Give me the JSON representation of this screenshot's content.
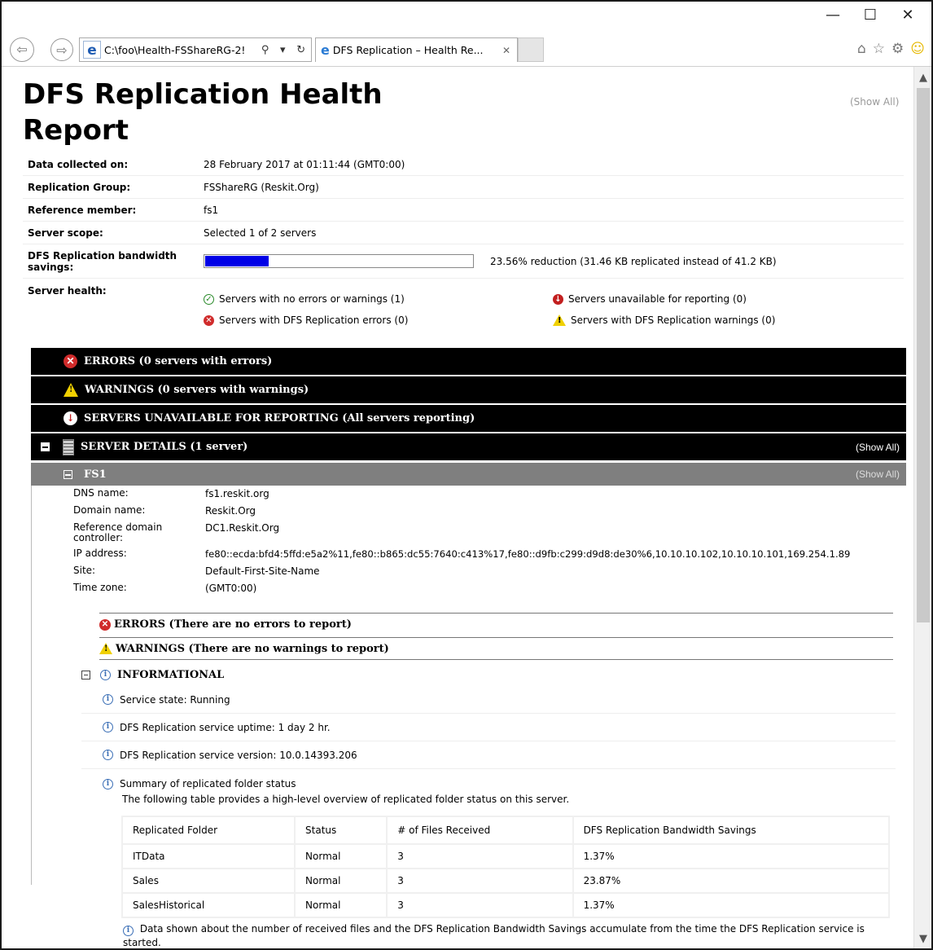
{
  "browser": {
    "address": "C:\\foo\\Health-FSShareRG-2!",
    "tab_title": "DFS Replication – Health Re...",
    "window_controls": [
      "—",
      "☐",
      "✕"
    ]
  },
  "report": {
    "title": "DFS Replication Health Report",
    "show_all": "(Show All)",
    "meta": [
      {
        "label": "Data collected on:",
        "value": "28 February 2017 at 01:11:44 (GMT0:00)"
      },
      {
        "label": "Replication Group:",
        "value": "FSShareRG (Reskit.Org)"
      },
      {
        "label": "Reference member:",
        "value": "fs1"
      },
      {
        "label": "Server scope:",
        "value": "Selected 1 of 2 servers"
      }
    ],
    "bandwidth": {
      "label": "DFS Replication bandwidth savings:",
      "percent": 23.56,
      "text": "23.56% reduction (31.46 KB replicated instead of 41.2 KB)"
    },
    "health": {
      "label": "Server health:",
      "ok": "Servers with no errors or warnings (1)",
      "errors": "Servers with DFS Replication errors (0)",
      "unavailable": "Servers unavailable for reporting (0)",
      "warnings": "Servers with DFS Replication warnings (0)"
    },
    "sections": {
      "errors": "ERRORS  (0 servers with errors)",
      "warnings": "WARNINGS  (0 servers with warnings)",
      "unavailable": "SERVERS UNAVAILABLE FOR REPORTING  (All servers reporting)",
      "details": "SERVER DETAILS  (1 server)",
      "details_show_all": "(Show All)"
    },
    "server": {
      "name": "FS1",
      "show_all": "(Show All)",
      "fields": [
        {
          "label": "DNS name:",
          "value": "fs1.reskit.org"
        },
        {
          "label": "Domain name:",
          "value": "Reskit.Org"
        },
        {
          "label": "Reference domain controller:",
          "value": "DC1.Reskit.Org"
        },
        {
          "label": "IP address:",
          "value": "fe80::ecda:bfd4:5ffd:e5a2%11,fe80::b865:dc55:7640:c413%17,fe80::d9fb:c299:d9d8:de30%6,10.10.10.102,10.10.10.101,169.254.1.89"
        },
        {
          "label": "Site:",
          "value": "Default-First-Site-Name"
        },
        {
          "label": "Time zone:",
          "value": "(GMT0:00)"
        }
      ],
      "errors": "ERRORS (There are no errors to report)",
      "warnings": "WARNINGS (There are no warnings to report)",
      "informational": "INFORMATIONAL",
      "info_items": [
        "Service state: Running",
        "DFS Replication service uptime: 1 day 2 hr.",
        "DFS Replication service version: 10.0.14393.206",
        "Summary of replicated folder status"
      ],
      "summary_desc": "The following table provides a high-level overview of replicated folder status on this server.",
      "table": {
        "headers": [
          "Replicated Folder",
          "Status",
          "# of Files Received",
          "DFS Replication Bandwidth Savings"
        ],
        "rows": [
          [
            "ITData",
            "Normal",
            "3",
            "1.37%"
          ],
          [
            "Sales",
            "Normal",
            "3",
            "23.87%"
          ],
          [
            "SalesHistorical",
            "Normal",
            "3",
            "1.37%"
          ]
        ]
      },
      "footnote": "Data shown about the number of received files and the DFS Replication Bandwidth Savings accumulate from the time the DFS Replication service is started."
    }
  },
  "colors": {
    "bar_fill": "#0000e6",
    "section_bg": "#000000",
    "server_bg": "#7f7f7f"
  }
}
